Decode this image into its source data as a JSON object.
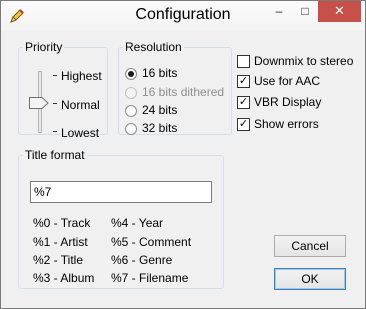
{
  "window": {
    "title": "Configuration",
    "app_icon": "pencil-icon",
    "controls": {
      "minimize": "–",
      "maximize": "□",
      "close": "✕"
    }
  },
  "priority": {
    "legend": "Priority",
    "levels": [
      "Highest",
      "Normal",
      "Lowest"
    ],
    "selected": "Normal"
  },
  "resolution": {
    "legend": "Resolution",
    "options": [
      {
        "label": "16 bits",
        "checked": true,
        "enabled": true
      },
      {
        "label": "16 bits dithered",
        "checked": false,
        "enabled": false
      },
      {
        "label": "24 bits",
        "checked": false,
        "enabled": false
      },
      {
        "label": "32 bits",
        "checked": false,
        "enabled": true
      }
    ]
  },
  "checkboxes": [
    {
      "label": "Downmix to stereo",
      "checked": false
    },
    {
      "label": "Use for AAC",
      "checked": true
    },
    {
      "label": "VBR Display",
      "checked": true
    },
    {
      "label": "Show errors",
      "checked": true
    }
  ],
  "title_format": {
    "legend": "Title format",
    "value": "%7",
    "tokens_left": [
      "%0 - Track",
      "%1 - Artist",
      "%2 - Title",
      "%3 - Album"
    ],
    "tokens_right": [
      "%4 - Year",
      "%5 - Comment",
      "%6 - Genre",
      "%7 - Filename"
    ]
  },
  "buttons": {
    "cancel": "Cancel",
    "ok": "OK"
  },
  "colors": {
    "close_button": "#c7504b",
    "frame": "#f0f0f0"
  }
}
